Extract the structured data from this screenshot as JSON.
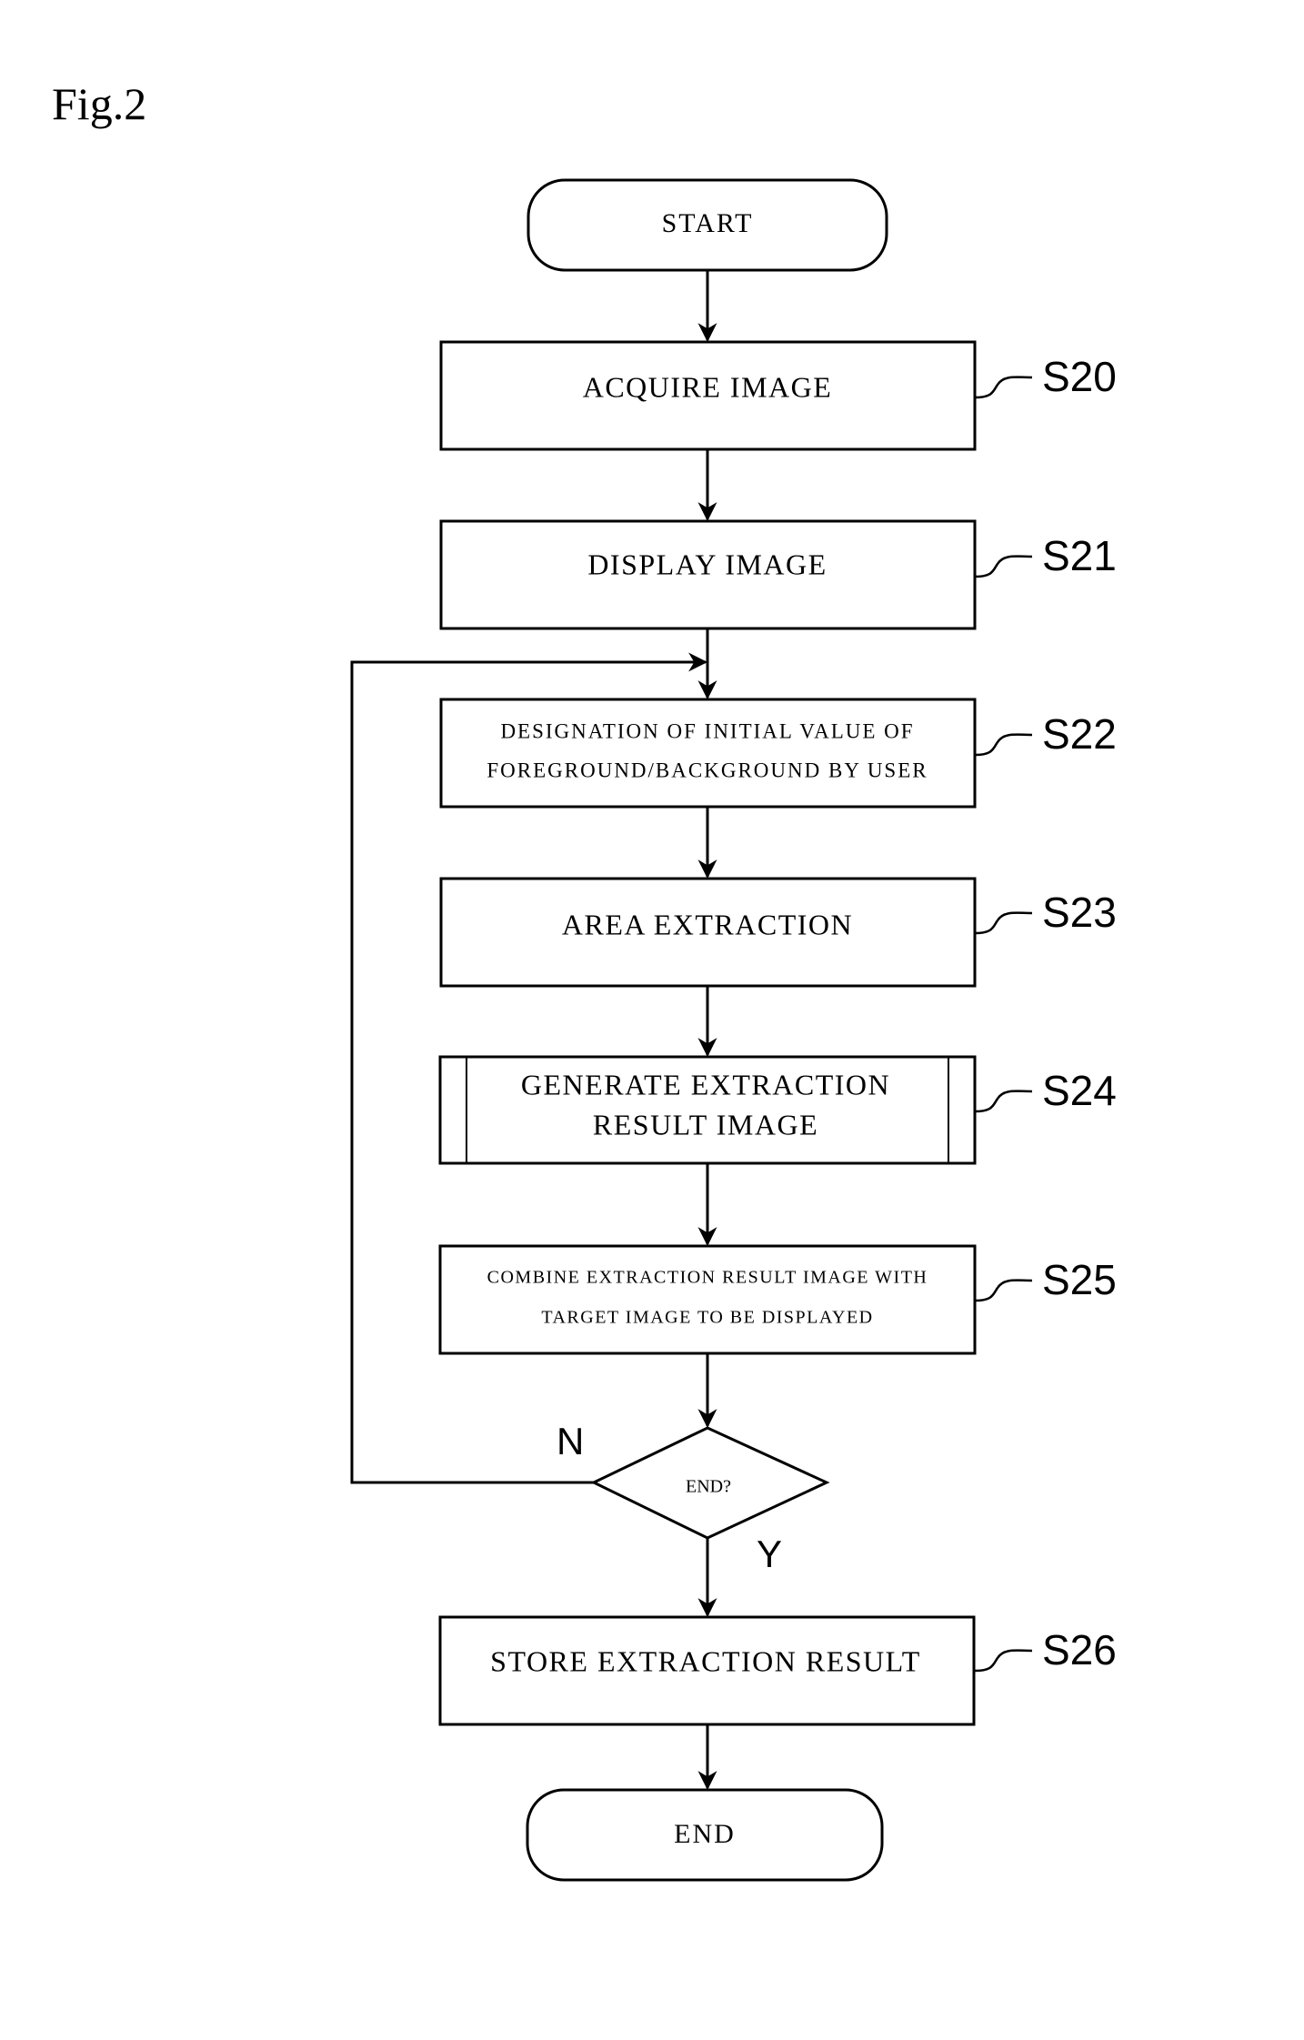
{
  "figure": {
    "title": "Fig.2"
  },
  "nodes": {
    "start": {
      "text": "START"
    },
    "s20": {
      "lines": [
        "ACQUIRE IMAGE"
      ],
      "step": "S20"
    },
    "s21": {
      "lines": [
        "DISPLAY IMAGE"
      ],
      "step": "S21"
    },
    "s22": {
      "lines": [
        "DESIGNATION OF INITIAL VALUE OF",
        "FOREGROUND/BACKGROUND BY USER"
      ],
      "step": "S22"
    },
    "s23": {
      "lines": [
        "AREA EXTRACTION"
      ],
      "step": "S23"
    },
    "s24": {
      "lines": [
        "GENERATE EXTRACTION",
        "RESULT IMAGE"
      ],
      "step": "S24",
      "predefined_process": true
    },
    "s25": {
      "lines": [
        "COMBINE EXTRACTION RESULT IMAGE WITH",
        "TARGET IMAGE TO BE DISPLAYED"
      ],
      "step": "S25"
    },
    "decision": {
      "text": "END?",
      "no_label": "N",
      "yes_label": "Y"
    },
    "s26": {
      "lines": [
        "STORE EXTRACTION RESULT"
      ],
      "step": "S26"
    },
    "end": {
      "text": "END"
    }
  },
  "flow": [
    [
      "start",
      "s20"
    ],
    [
      "s20",
      "s21"
    ],
    [
      "s21",
      "s22"
    ],
    [
      "s22",
      "s23"
    ],
    [
      "s23",
      "s24"
    ],
    [
      "s24",
      "s25"
    ],
    [
      "s25",
      "decision"
    ],
    [
      "decision",
      "s26",
      "Y"
    ],
    [
      "decision",
      "s22",
      "N"
    ],
    [
      "s26",
      "end"
    ]
  ]
}
